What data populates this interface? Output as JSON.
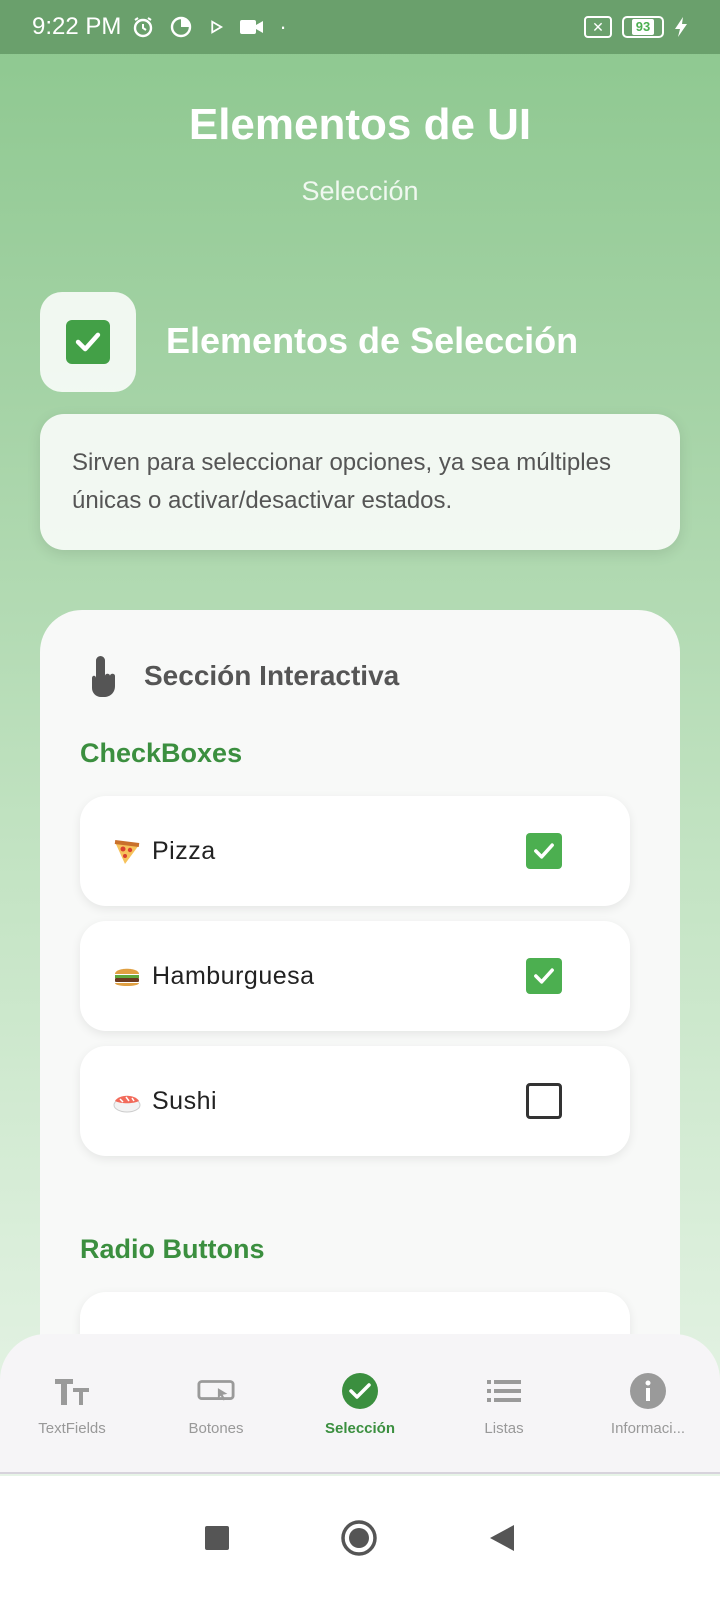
{
  "status_bar": {
    "time": "9:22 PM",
    "battery": "93",
    "icons": [
      "alarm-icon",
      "data-saver-icon",
      "play-icon",
      "video-icon",
      "dot-icon",
      "x-box-icon",
      "battery-icon",
      "charging-icon"
    ]
  },
  "header": {
    "title": "Elementos de UI",
    "subtitle": "Selección"
  },
  "section": {
    "icon": "check-box-emoji",
    "title": "Elementos de Selección",
    "description": "Sirven para seleccionar opciones, ya sea múltiples únicas o activar/desactivar estados."
  },
  "interactive": {
    "title": "Sección Interactiva",
    "icon": "touch-hand-icon",
    "checkboxes_label": "CheckBoxes",
    "checkboxes": [
      {
        "icon": "pizza-icon",
        "label": "Pizza",
        "checked": true
      },
      {
        "icon": "burger-icon",
        "label": "Hamburguesa",
        "checked": true
      },
      {
        "icon": "sushi-icon",
        "label": "Sushi",
        "checked": false
      }
    ],
    "radio_label": "Radio Buttons"
  },
  "bottom_nav": {
    "items": [
      {
        "label": "TextFields",
        "icon": "text-fields-icon",
        "active": false
      },
      {
        "label": "Botones",
        "icon": "button-icon",
        "active": false
      },
      {
        "label": "Selección",
        "icon": "check-circle-icon",
        "active": true
      },
      {
        "label": "Listas",
        "icon": "list-icon",
        "active": false
      },
      {
        "label": "Informaci...",
        "icon": "info-icon",
        "active": false
      }
    ]
  },
  "colors": {
    "accent": "#4caf50",
    "accent_dark": "#3b8f3f",
    "status_bar": "#6aa06c"
  }
}
